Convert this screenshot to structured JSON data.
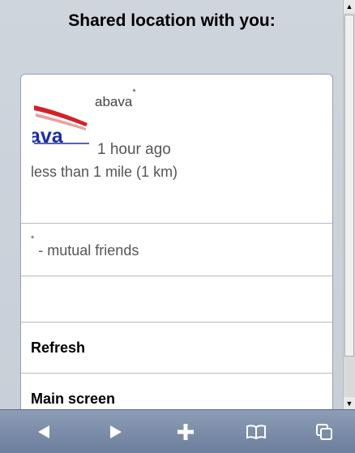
{
  "header": {
    "title": "Shared location with you:"
  },
  "friend": {
    "logo_text": "ava",
    "name": "abava",
    "mutual_marker": "*",
    "time": "1 hour ago",
    "distance": "less than 1 mile (1 km)"
  },
  "note": {
    "marker": "*",
    "text": " - mutual friends"
  },
  "links": {
    "refresh": "Refresh",
    "main_screen": "Main screen"
  },
  "scrollbar": {
    "up_arrow": "▲",
    "down_arrow": "▼"
  },
  "toolbar": {
    "icons": [
      "back-arrow-icon",
      "forward-arrow-icon",
      "add-icon",
      "bookmarks-book-icon",
      "pages-icon"
    ]
  },
  "colors": {
    "toolbar": "#7a8ca8",
    "logo_red": "#d32027",
    "logo_blue": "#1c2fa0"
  }
}
